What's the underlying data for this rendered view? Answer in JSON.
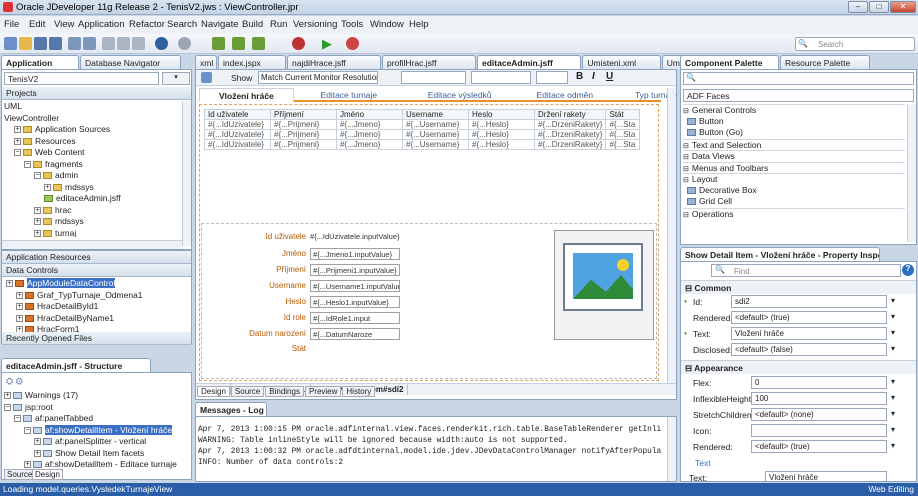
{
  "window": {
    "title": "Oracle JDeveloper 11g Release 2 - TenisV2.jws : ViewController.jpr",
    "min": "–",
    "max": "□",
    "close": "✕"
  },
  "menu": [
    "File",
    "Edit",
    "View",
    "Application",
    "Refactor",
    "Search",
    "Navigate",
    "Build",
    "Run",
    "Versioning",
    "Tools",
    "Window",
    "Help"
  ],
  "toolbar": {
    "search_placeholder": "Search"
  },
  "left": {
    "tabs": [
      "Application",
      "Database Navigator"
    ],
    "app_selector": "TenisV2",
    "projects_label": "Projects",
    "tree": [
      {
        "indent": 0,
        "pm": "",
        "label": "UML",
        "icon": "none"
      },
      {
        "indent": 0,
        "pm": "",
        "label": "ViewController",
        "icon": "none"
      },
      {
        "indent": 1,
        "pm": "+",
        "label": "Application Sources",
        "icon": "folder"
      },
      {
        "indent": 1,
        "pm": "+",
        "label": "Resources",
        "icon": "folder"
      },
      {
        "indent": 1,
        "pm": "−",
        "label": "Web Content",
        "icon": "folder"
      },
      {
        "indent": 2,
        "pm": "−",
        "label": "fragments",
        "icon": "folder"
      },
      {
        "indent": 3,
        "pm": "−",
        "label": "admin",
        "icon": "folder"
      },
      {
        "indent": 4,
        "pm": "+",
        "label": "mdssys",
        "icon": "folder"
      },
      {
        "indent": 4,
        "pm": "",
        "label": "editaceAdmin.jsff",
        "icon": "file"
      },
      {
        "indent": 3,
        "pm": "+",
        "label": "hrac",
        "icon": "folder"
      },
      {
        "indent": 3,
        "pm": "+",
        "label": "mdssys",
        "icon": "folder"
      },
      {
        "indent": 3,
        "pm": "+",
        "label": "turnaj",
        "icon": "folder"
      }
    ],
    "app_resources": "Application Resources",
    "data_controls": "Data Controls",
    "dc_tree": [
      {
        "label": "AppModuleDataControl",
        "selected": true,
        "indent": 0
      },
      {
        "label": "Graf_TypTurnaje_Odmena1",
        "selected": false,
        "indent": 1
      },
      {
        "label": "HracDetailById1",
        "selected": false,
        "indent": 1
      },
      {
        "label": "HracDetailByName1",
        "selected": false,
        "indent": 1
      },
      {
        "label": "HracForm1",
        "selected": false,
        "indent": 1
      },
      {
        "label": "HracForm1Hrac1",
        "selected": false,
        "indent": 1
      }
    ],
    "recent_files": "Recently Opened Files"
  },
  "structure": {
    "tab": "editaceAdmin.jsff - Structure",
    "tree": [
      {
        "indent": 0,
        "pm": "+",
        "label": "Warnings (17)",
        "sel": false
      },
      {
        "indent": 0,
        "pm": "−",
        "label": "jsp:root",
        "sel": false
      },
      {
        "indent": 1,
        "pm": "−",
        "label": "af:panelTabbed",
        "sel": false
      },
      {
        "indent": 2,
        "pm": "−",
        "label": "af:showDetailItem - Vložení hráče",
        "sel": true
      },
      {
        "indent": 3,
        "pm": "+",
        "label": "af:panelSplitter - vertical",
        "sel": false
      },
      {
        "indent": 3,
        "pm": "+",
        "label": "Show Detail Item facets",
        "sel": false
      },
      {
        "indent": 2,
        "pm": "+",
        "label": "af:showDetailItem - Editace turnaje",
        "sel": false
      }
    ],
    "bottom_tabs": [
      "Source",
      "Design"
    ]
  },
  "editor": {
    "tabs": [
      "xml",
      "index.jspx",
      "najdiHrace.jsff",
      "profilHrac.jsff",
      "editaceAdmin.jsff",
      "Umisteni.xml",
      "UmisteniImpl"
    ],
    "active_tab": "editaceAdmin.jsff",
    "show_label": "Show",
    "show_value": "Match Current Monitor Resolution",
    "page_tabs": [
      "Vložení hráče",
      "Editace turnaje",
      "Editace výsledků",
      "Editace odměn",
      "Typ turnaje",
      "Umístění"
    ],
    "grid_headers": [
      "Id uživatele",
      "Příjmení",
      "Jméno",
      "Username",
      "Heslo",
      "Držení rakety",
      "Stát"
    ],
    "grid_rows": [
      [
        "#{...IdUzivatele}",
        "#{...Prijmeni}",
        "#{...Jmeno}",
        "#{...Username}",
        "#{...Heslo}",
        "#{...DrzeniRakety}",
        "#{...Sta"
      ],
      [
        "#{...IdUzivatele}",
        "#{...Prijmeni}",
        "#{...Jmeno}",
        "#{...Username}",
        "#{...Heslo}",
        "#{...DrzeniRakety}",
        "#{...Sta"
      ],
      [
        "#{...IdUzivatele}",
        "#{...Prijmeni}",
        "#{...Jmeno}",
        "#{...Username}",
        "#{...Heslo}",
        "#{...DrzeniRakety}",
        "#{...Sta"
      ]
    ],
    "form": [
      {
        "label": "Id uživatele",
        "value": "#{...IdUzivatele.inputValue}",
        "box": false
      },
      {
        "label": "Jméno",
        "value": "#{...Jmeno1.inputValue}",
        "box": true
      },
      {
        "label": "Příjmení",
        "value": "#{...Prijmeni1.inputValue}",
        "box": true
      },
      {
        "label": "Username",
        "value": "#{...Username1.inputValue}",
        "box": true
      },
      {
        "label": "Heslo",
        "value": "#{...Heslo1.inputValue}",
        "box": true
      },
      {
        "label": "Id role",
        "value": "#{...IdRole1.input",
        "box": true
      },
      {
        "label": "Datum narození",
        "value": "#{...DatumNaroze",
        "box": true
      },
      {
        "label": "Stát",
        "value": "",
        "box": false
      }
    ],
    "breadcrumb": [
      "jsp:root",
      "af:panelTabbed#pt1",
      "af:showDetailItem#sdi2"
    ],
    "bottom_tabs": [
      "Design",
      "Source",
      "Bindings",
      "Preview",
      "History"
    ]
  },
  "messages": {
    "tab": "Messages - Log",
    "lines": [
      "Apr 7, 2013 1:00:15 PM oracle.adfinternal.view.faces.renderkit.rich.table.BaseTableRenderer getInli",
      "WARNING: Table inlineStyle will be ignored because width:auto is not supported.",
      "Apr 7, 2013 1:00:32 PM oracle.adfdtinternal.model.ide.jdev.JDevDataControlManager notifyAfterPopula",
      "INFO: Number of data controls:2"
    ]
  },
  "palette": {
    "tabs": [
      "Component Palette",
      "Resource Palette"
    ],
    "library": "ADF Faces",
    "sections": [
      {
        "type": "hdr",
        "label": "General Controls"
      },
      {
        "type": "item",
        "label": "Button"
      },
      {
        "type": "item",
        "label": "Button (Go)"
      },
      {
        "type": "hdr",
        "label": "Text and Selection"
      },
      {
        "type": "hdr",
        "label": "Data Views"
      },
      {
        "type": "hdr",
        "label": "Menus and Toolbars"
      },
      {
        "type": "hdr",
        "label": "Layout"
      },
      {
        "type": "item",
        "label": "Decorative Box"
      },
      {
        "type": "item",
        "label": "Grid Cell"
      },
      {
        "type": "hdr",
        "label": "Operations"
      }
    ]
  },
  "inspector": {
    "tab": "Show Detail Item - Vložení hráče - Property Inspector",
    "find_placeholder": "Find",
    "common_label": "Common",
    "appearance_label": "Appearance",
    "common": [
      {
        "label": "Id:",
        "value": "sdi2",
        "dot": true
      },
      {
        "label": "Rendered:",
        "value": "<default> (true)",
        "dot": false
      },
      {
        "label": "Text:",
        "value": "Vložení hráče",
        "dot": true
      },
      {
        "label": "Disclosed:",
        "value": "<default> (false)",
        "dot": false
      }
    ],
    "appearance": [
      {
        "label": "Flex:",
        "value": "0"
      },
      {
        "label": "InflexibleHeight:",
        "value": "100"
      },
      {
        "label": "StretchChildren:",
        "value": "<default> (none)"
      },
      {
        "label": "Icon:",
        "value": ""
      },
      {
        "label": "Rendered:",
        "value": "<default> (true)"
      }
    ],
    "text_link": "Text",
    "last_label": "Text:",
    "last_value": "Vložení hráče"
  },
  "status": {
    "left": "Loading   model.queries.VysledekTurnajeView",
    "right": "Web Editing"
  },
  "colors": {
    "accent": "#3a6fc4",
    "frame": "#c9d6e6",
    "label_orange": "#b75a00"
  }
}
